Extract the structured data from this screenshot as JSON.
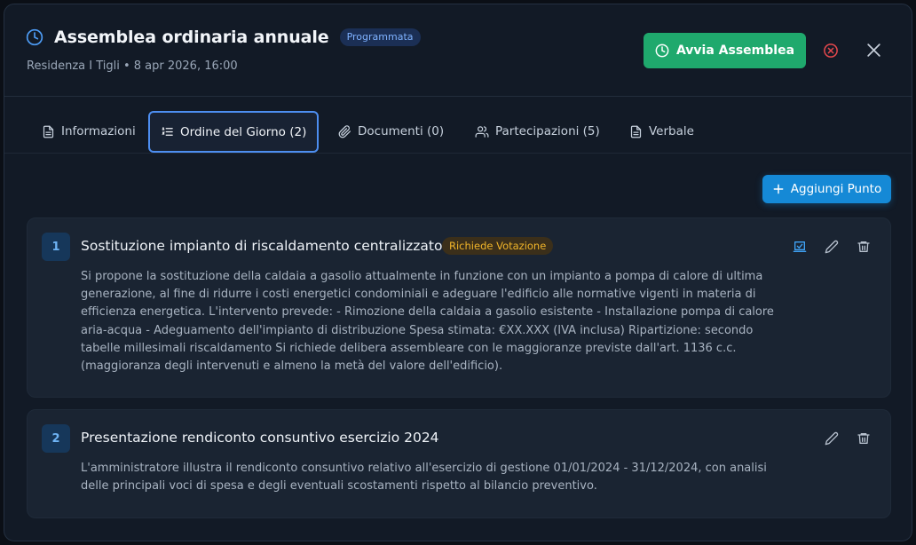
{
  "header": {
    "title": "Assemblea ordinaria annuale",
    "status": "Programmata",
    "subtitle": "Residenza I Tigli • 8 apr 2026, 16:00",
    "start_button": "Avvia Assemblea"
  },
  "tabs": [
    {
      "label": "Informazioni",
      "icon": "file-text-icon"
    },
    {
      "label": "Ordine del Giorno (2)",
      "icon": "list-ordered-icon",
      "active": true
    },
    {
      "label": "Documenti (0)",
      "icon": "paperclip-icon"
    },
    {
      "label": "Partecipazioni (5)",
      "icon": "users-icon"
    },
    {
      "label": "Verbale",
      "icon": "file-text-icon"
    }
  ],
  "add_button": "Aggiungi Punto",
  "items": [
    {
      "number": "1",
      "title": "Sostituzione impianto di riscaldamento centralizzato",
      "badge": "Richiede Votazione",
      "description": "Si propone la sostituzione della caldaia a gasolio attualmente in funzione con un impianto a pompa di calore di ultima generazione, al fine di ridurre i costi energetici condominiali e adeguare l'edificio alle normative vigenti in materia di efficienza energetica. L'intervento prevede: - Rimozione della caldaia a gasolio esistente - Installazione pompa di calore aria-acqua - Adeguamento dell'impianto di distribuzione Spesa stimata: €XX.XXX (IVA inclusa) Ripartizione: secondo tabelle millesimali riscaldamento Si richiede delibera assembleare con le maggioranze previste dall'art. 1136 c.c. (maggioranza degli intervenuti e almeno la metà del valore dell'edificio)."
    },
    {
      "number": "2",
      "title": "Presentazione rendiconto consuntivo esercizio 2024",
      "description": "L'amministratore illustra il rendiconto consuntivo relativo all'esercizio di gestione 01/01/2024 - 31/12/2024, con analisi delle principali voci di spesa e degli eventuali scostamenti rispetto al bilancio preventivo."
    }
  ],
  "colors": {
    "accent": "#1589d6",
    "success": "#1fa96d",
    "danger": "#e5484d",
    "warning": "#f0b429"
  }
}
